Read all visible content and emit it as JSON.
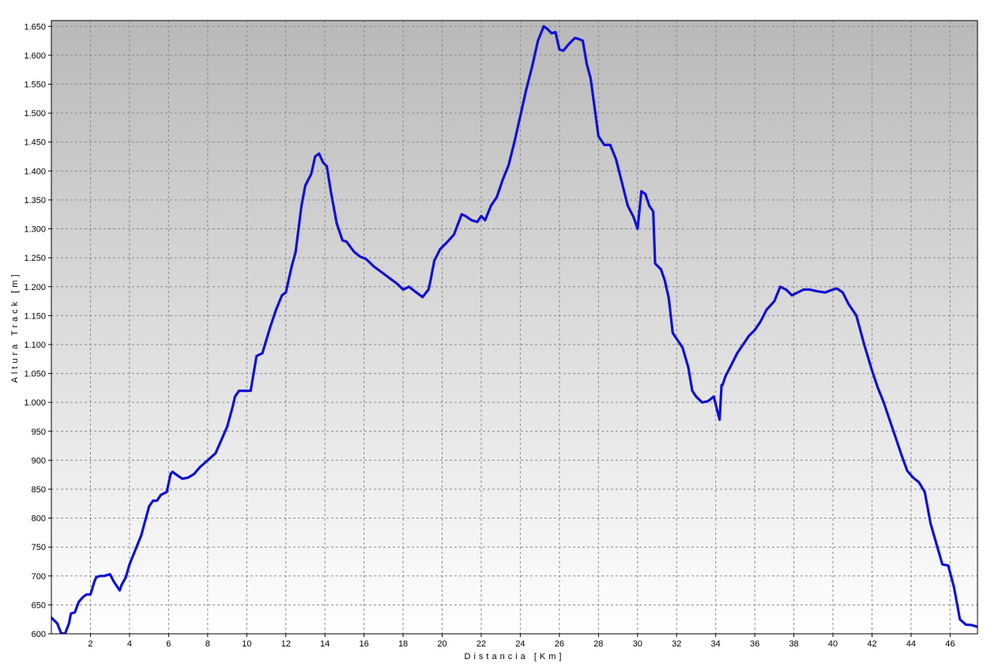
{
  "chart_data": {
    "type": "line",
    "title": "",
    "xlabel": "Distancia [Km]",
    "ylabel": "Altura Track [m]",
    "xlim": [
      0,
      47.4
    ],
    "ylim": [
      600,
      1660
    ],
    "x_ticks": [
      {
        "value": 2,
        "label": "2"
      },
      {
        "value": 4,
        "label": "4"
      },
      {
        "value": 6,
        "label": "6"
      },
      {
        "value": 8,
        "label": "8"
      },
      {
        "value": 10,
        "label": "10"
      },
      {
        "value": 12,
        "label": "12"
      },
      {
        "value": 14,
        "label": "14"
      },
      {
        "value": 16,
        "label": "16"
      },
      {
        "value": 18,
        "label": "18"
      },
      {
        "value": 20,
        "label": "20"
      },
      {
        "value": 22,
        "label": "22"
      },
      {
        "value": 24,
        "label": "24"
      },
      {
        "value": 26,
        "label": "26"
      },
      {
        "value": 28,
        "label": "28"
      },
      {
        "value": 30,
        "label": "30"
      },
      {
        "value": 32,
        "label": "32"
      },
      {
        "value": 34,
        "label": "34"
      },
      {
        "value": 36,
        "label": "36"
      },
      {
        "value": 38,
        "label": "38"
      },
      {
        "value": 40,
        "label": "40"
      },
      {
        "value": 42,
        "label": "42"
      },
      {
        "value": 44,
        "label": "44"
      },
      {
        "value": 46,
        "label": "46"
      }
    ],
    "y_ticks": [
      {
        "value": 600,
        "label": "600"
      },
      {
        "value": 650,
        "label": "650"
      },
      {
        "value": 700,
        "label": "700"
      },
      {
        "value": 750,
        "label": "750"
      },
      {
        "value": 800,
        "label": "800"
      },
      {
        "value": 850,
        "label": "850"
      },
      {
        "value": 900,
        "label": "900"
      },
      {
        "value": 950,
        "label": "950"
      },
      {
        "value": 1000,
        "label": "1.000"
      },
      {
        "value": 1050,
        "label": "1.050"
      },
      {
        "value": 1100,
        "label": "1.100"
      },
      {
        "value": 1150,
        "label": "1.150"
      },
      {
        "value": 1200,
        "label": "1.200"
      },
      {
        "value": 1250,
        "label": "1.250"
      },
      {
        "value": 1300,
        "label": "1.300"
      },
      {
        "value": 1350,
        "label": "1.350"
      },
      {
        "value": 1400,
        "label": "1.400"
      },
      {
        "value": 1450,
        "label": "1.450"
      },
      {
        "value": 1500,
        "label": "1.500"
      },
      {
        "value": 1550,
        "label": "1.550"
      },
      {
        "value": 1600,
        "label": "1.600"
      },
      {
        "value": 1650,
        "label": "1.650"
      }
    ],
    "grid": true,
    "colors": {
      "line": "#1010d8",
      "grid": "#8a8a8a",
      "bg_top": "#b9b9b9",
      "bg_bottom": "#ffffff",
      "axis": "#000000"
    },
    "series": [
      {
        "name": "",
        "x": [
          0,
          0.3,
          0.5,
          0.7,
          0.9,
          1.0,
          1.2,
          1.4,
          1.6,
          1.8,
          2.0,
          2.2,
          2.3,
          2.5,
          2.7,
          3.0,
          3.2,
          3.5,
          3.6,
          3.8,
          4.0,
          4.3,
          4.6,
          5.0,
          5.2,
          5.4,
          5.6,
          5.9,
          6.0,
          6.1,
          6.2,
          6.4,
          6.7,
          7.0,
          7.3,
          7.6,
          8.0,
          8.4,
          8.7,
          9.0,
          9.3,
          9.4,
          9.6,
          10.0,
          10.2,
          10.5,
          10.8,
          11.2,
          11.5,
          11.8,
          12.0,
          12.3,
          12.5,
          12.8,
          13.0,
          13.3,
          13.5,
          13.7,
          13.9,
          14.1,
          14.3,
          14.6,
          14.9,
          15.1,
          15.5,
          15.8,
          16.1,
          16.5,
          16.9,
          17.3,
          17.7,
          18.0,
          18.3,
          18.6,
          19.0,
          19.3,
          19.4,
          19.6,
          19.9,
          20.2,
          20.6,
          21.0,
          21.2,
          21.5,
          21.8,
          22.0,
          22.2,
          22.5,
          22.8,
          23.1,
          23.4,
          23.7,
          24.0,
          24.3,
          24.6,
          24.9,
          25.2,
          25.4,
          25.6,
          25.8,
          26.0,
          26.2,
          26.5,
          26.8,
          27.0,
          27.2,
          27.4,
          27.6,
          27.8,
          28.0,
          28.3,
          28.6,
          28.9,
          29.2,
          29.5,
          29.8,
          30.0,
          30.2,
          30.4,
          30.6,
          30.8,
          30.9,
          31.2,
          31.4,
          31.6,
          31.8,
          32.0,
          32.3,
          32.6,
          32.8,
          33.0,
          33.3,
          33.6,
          33.9,
          34.2,
          34.3,
          34.35,
          34.5,
          34.8,
          35.1,
          35.4,
          35.7,
          36.0,
          36.3,
          36.6,
          37.0,
          37.3,
          37.6,
          37.9,
          38.2,
          38.5,
          38.8,
          39.2,
          39.6,
          40.0,
          40.2,
          40.5,
          40.8,
          41.2,
          41.6,
          42.0,
          42.3,
          42.6,
          42.9,
          43.2,
          43.5,
          43.8,
          44.1,
          44.4,
          44.7,
          45.0,
          45.3,
          45.6,
          45.9,
          46.2,
          46.5,
          46.8,
          47.1,
          47.4
        ],
        "y": [
          628,
          618,
          601,
          600,
          618,
          635,
          637,
          655,
          663,
          668,
          668,
          690,
          698,
          700,
          700,
          703,
          690,
          675,
          685,
          697,
          720,
          745,
          770,
          820,
          830,
          830,
          840,
          845,
          860,
          876,
          880,
          875,
          868,
          870,
          876,
          888,
          900,
          912,
          935,
          958,
          995,
          1010,
          1020,
          1020,
          1020,
          1080,
          1085,
          1130,
          1160,
          1185,
          1190,
          1235,
          1260,
          1340,
          1375,
          1395,
          1425,
          1430,
          1415,
          1408,
          1365,
          1310,
          1280,
          1278,
          1260,
          1252,
          1248,
          1235,
          1225,
          1215,
          1205,
          1195,
          1200,
          1192,
          1182,
          1195,
          1210,
          1245,
          1265,
          1275,
          1290,
          1325,
          1322,
          1315,
          1312,
          1322,
          1315,
          1340,
          1355,
          1385,
          1410,
          1450,
          1495,
          1540,
          1580,
          1625,
          1650,
          1645,
          1638,
          1640,
          1610,
          1608,
          1620,
          1630,
          1628,
          1625,
          1585,
          1560,
          1510,
          1460,
          1445,
          1445,
          1420,
          1380,
          1340,
          1320,
          1300,
          1365,
          1360,
          1340,
          1330,
          1240,
          1230,
          1210,
          1180,
          1120,
          1110,
          1095,
          1060,
          1020,
          1010,
          1000,
          1002,
          1010,
          970,
          1030,
          1030,
          1045,
          1065,
          1085,
          1100,
          1115,
          1125,
          1140,
          1160,
          1175,
          1200,
          1195,
          1185,
          1190,
          1195,
          1195,
          1192,
          1190,
          1195,
          1197,
          1190,
          1170,
          1150,
          1100,
          1055,
          1025,
          1000,
          970,
          940,
          910,
          882,
          870,
          862,
          845,
          790,
          755,
          720,
          718,
          680,
          625,
          616,
          615,
          612
        ]
      }
    ]
  }
}
